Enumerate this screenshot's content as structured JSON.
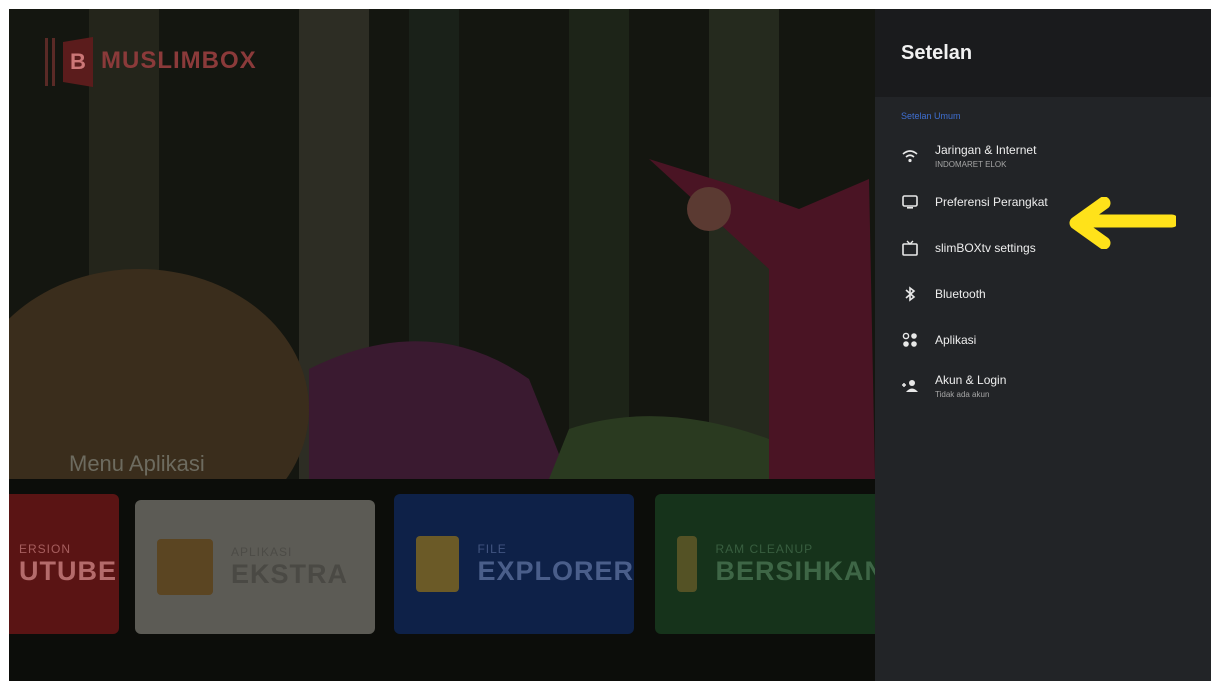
{
  "brand": {
    "title": "MUSLIMBOX",
    "subtitle": "",
    "accent_color": "#5b1c1c"
  },
  "launcher": {
    "menu_title": "Menu Aplikasi",
    "tiles": [
      {
        "small": "ERSION",
        "big": "UTUBE",
        "color": "#5a1414"
      },
      {
        "small": "APLIKASI",
        "big": "EKSTRA",
        "color": "#5c5b55",
        "icon": "box-icon"
      },
      {
        "small": "FILE",
        "big": "EXPLORER",
        "color": "#0e2148",
        "icon": "folder-icon"
      },
      {
        "small": "RAM CLEANUP",
        "big": "BERSIHKAN",
        "color": "#16331b",
        "icon": "broom-icon"
      }
    ]
  },
  "settings": {
    "title": "Setelan",
    "section_label": "Setelan Umum",
    "accent_color": "#3f6fd1",
    "items": [
      {
        "label": "Jaringan & Internet",
        "sub": "INDOMARET ELOK",
        "icon": "wifi-icon"
      },
      {
        "label": "Preferensi Perangkat",
        "sub": "",
        "icon": "monitor-icon"
      },
      {
        "label": "slimBOXtv settings",
        "sub": "",
        "icon": "tv-icon"
      },
      {
        "label": "Bluetooth",
        "sub": "",
        "icon": "bluetooth-icon"
      },
      {
        "label": "Aplikasi",
        "sub": "",
        "icon": "apps-grid-icon"
      },
      {
        "label": "Akun & Login",
        "sub": "Tidak ada akun",
        "icon": "add-account-icon"
      }
    ]
  },
  "annotation": {
    "arrow_color": "#ffe21a",
    "points_to": "Preferensi Perangkat"
  }
}
